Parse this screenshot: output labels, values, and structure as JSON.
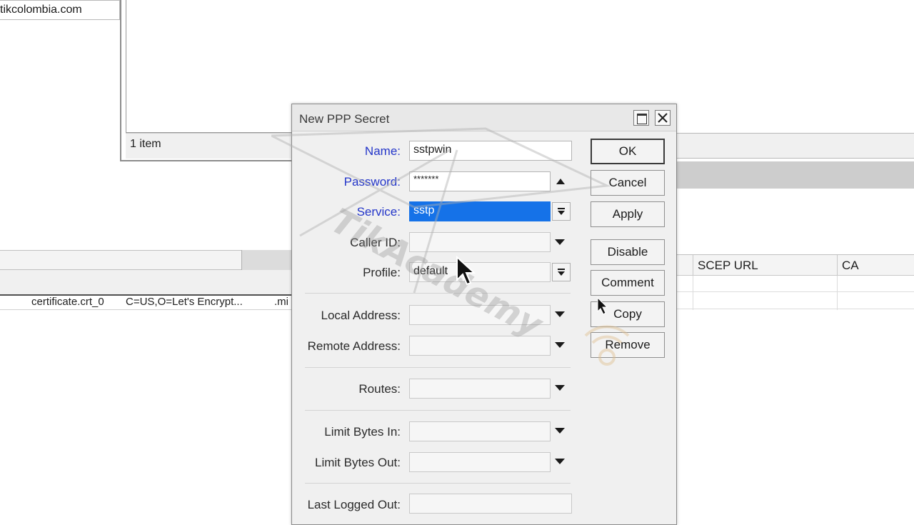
{
  "background": {
    "top_left_text": "tikcolombia.com",
    "status_text": "1 item",
    "left_row_cells": [
      "certificate.crt_0",
      "C=US,O=Let's Encrypt...",
      ".mi"
    ],
    "right_columns": [
      "SCEP URL",
      "CA"
    ]
  },
  "dialog": {
    "title": "New PPP Secret",
    "fields": {
      "name": {
        "label": "Name:",
        "value": "sstpwin"
      },
      "password": {
        "label": "Password:",
        "value": "*******"
      },
      "service": {
        "label": "Service:",
        "value": "sstp"
      },
      "caller_id": {
        "label": "Caller ID:",
        "value": ""
      },
      "profile": {
        "label": "Profile:",
        "value": "default"
      },
      "local_address": {
        "label": "Local Address:",
        "value": ""
      },
      "remote_address": {
        "label": "Remote Address:",
        "value": ""
      },
      "routes": {
        "label": "Routes:",
        "value": ""
      },
      "limit_bytes_in": {
        "label": "Limit Bytes In:",
        "value": ""
      },
      "limit_bytes_out": {
        "label": "Limit Bytes Out:",
        "value": ""
      },
      "last_logged_out": {
        "label": "Last Logged Out:",
        "value": ""
      }
    },
    "buttons": {
      "ok": "OK",
      "cancel": "Cancel",
      "apply": "Apply",
      "disable": "Disable",
      "comment": "Comment",
      "copy": "Copy",
      "remove": "Remove"
    }
  },
  "colors": {
    "selection": "#1572e8",
    "label_blue": "#2436c9"
  }
}
